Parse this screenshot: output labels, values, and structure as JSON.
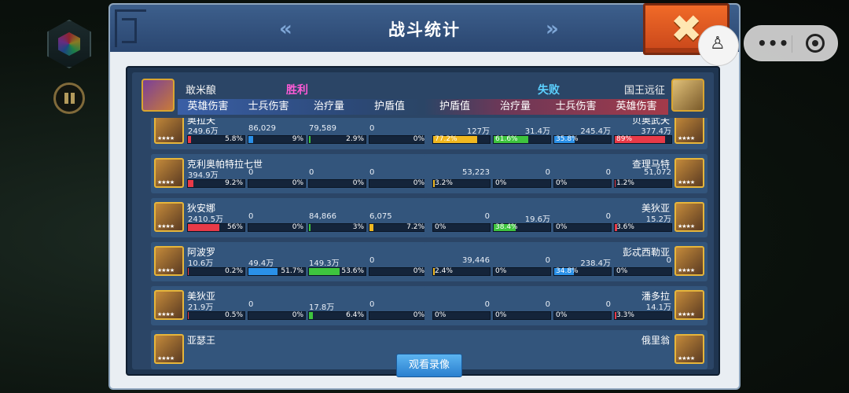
{
  "title": "战斗统计",
  "colors": {
    "accent": "#2a90e8",
    "win": "#ff5bd7",
    "lose": "#5bd0ff"
  },
  "left_team": {
    "player": "敢米酿",
    "result": "胜利",
    "columns": [
      "英雄伤害",
      "士兵伤害",
      "治疗量",
      "护盾值"
    ]
  },
  "right_team": {
    "player": "国王远征",
    "result": "失败",
    "columns": [
      "护盾值",
      "治疗量",
      "士兵伤害",
      "英雄伤害"
    ]
  },
  "rows": [
    {
      "left": {
        "name": "奥拉夫",
        "stats": [
          {
            "v": "249.6万",
            "p": "5.8%",
            "f": 0.058
          },
          {
            "v": "86,029",
            "p": "9%",
            "f": 0.09
          },
          {
            "v": "79,589",
            "p": "2.9%",
            "f": 0.029
          },
          {
            "v": "0",
            "p": "0%",
            "f": 0
          }
        ]
      },
      "right": {
        "name": "贝奥武夫",
        "stats": [
          {
            "v": "127万",
            "p": "77.2%",
            "f": 0.772
          },
          {
            "v": "31.4万",
            "p": "61.6%",
            "f": 0.616
          },
          {
            "v": "245.4万",
            "p": "35.8%",
            "f": 0.358
          },
          {
            "v": "377.4万",
            "p": "89%",
            "f": 0.89
          }
        ]
      }
    },
    {
      "left": {
        "name": "克利奥帕特拉七世",
        "stats": [
          {
            "v": "394.9万",
            "p": "9.2%",
            "f": 0.092
          },
          {
            "v": "0",
            "p": "0%",
            "f": 0
          },
          {
            "v": "0",
            "p": "0%",
            "f": 0
          },
          {
            "v": "0",
            "p": "0%",
            "f": 0
          }
        ]
      },
      "right": {
        "name": "查理马特",
        "stats": [
          {
            "v": "53,223",
            "p": "3.2%",
            "f": 0.032
          },
          {
            "v": "0",
            "p": "0%",
            "f": 0
          },
          {
            "v": "0",
            "p": "0%",
            "f": 0
          },
          {
            "v": "51,072",
            "p": "1.2%",
            "f": 0.012
          }
        ]
      }
    },
    {
      "left": {
        "name": "狄安娜",
        "stats": [
          {
            "v": "2410.5万",
            "p": "56%",
            "f": 0.56
          },
          {
            "v": "0",
            "p": "0%",
            "f": 0
          },
          {
            "v": "84,866",
            "p": "3%",
            "f": 0.03
          },
          {
            "v": "6,075",
            "p": "7.2%",
            "f": 0.072
          }
        ]
      },
      "right": {
        "name": "美狄亚",
        "stats": [
          {
            "v": "0",
            "p": "0%",
            "f": 0
          },
          {
            "v": "19.6万",
            "p": "38.4%",
            "f": 0.384
          },
          {
            "v": "0",
            "p": "0%",
            "f": 0
          },
          {
            "v": "15.2万",
            "p": "3.6%",
            "f": 0.036
          }
        ]
      }
    },
    {
      "left": {
        "name": "阿波罗",
        "stats": [
          {
            "v": "10.6万",
            "p": "0.2%",
            "f": 0.002
          },
          {
            "v": "49.4万",
            "p": "51.7%",
            "f": 0.517
          },
          {
            "v": "149.3万",
            "p": "53.6%",
            "f": 0.536
          },
          {
            "v": "0",
            "p": "0%",
            "f": 0
          }
        ]
      },
      "right": {
        "name": "彭忒西勒亚",
        "stats": [
          {
            "v": "39,446",
            "p": "2.4%",
            "f": 0.024
          },
          {
            "v": "0",
            "p": "0%",
            "f": 0
          },
          {
            "v": "238.4万",
            "p": "34.8%",
            "f": 0.348
          },
          {
            "v": "0",
            "p": "0%",
            "f": 0
          }
        ]
      }
    },
    {
      "left": {
        "name": "美狄亚",
        "stats": [
          {
            "v": "21.9万",
            "p": "0.5%",
            "f": 0.005
          },
          {
            "v": "0",
            "p": "0%",
            "f": 0
          },
          {
            "v": "17.8万",
            "p": "6.4%",
            "f": 0.064
          },
          {
            "v": "0",
            "p": "0%",
            "f": 0
          }
        ]
      },
      "right": {
        "name": "潘多拉",
        "stats": [
          {
            "v": "0",
            "p": "0%",
            "f": 0
          },
          {
            "v": "0",
            "p": "0%",
            "f": 0
          },
          {
            "v": "0",
            "p": "0%",
            "f": 0
          },
          {
            "v": "14.1万",
            "p": "3.3%",
            "f": 0.033
          }
        ]
      }
    },
    {
      "left": {
        "name": "亚瑟王",
        "stats": []
      },
      "right": {
        "name": "俄里翁",
        "stats": []
      }
    }
  ],
  "watch_button": "观看录像",
  "icons": {
    "close": "close-x-icon",
    "prev": "double-chevron-left-icon",
    "next": "double-chevron-right-icon",
    "pause": "pause-icon",
    "more": "more-dots-icon",
    "exit": "target-circle-icon"
  }
}
